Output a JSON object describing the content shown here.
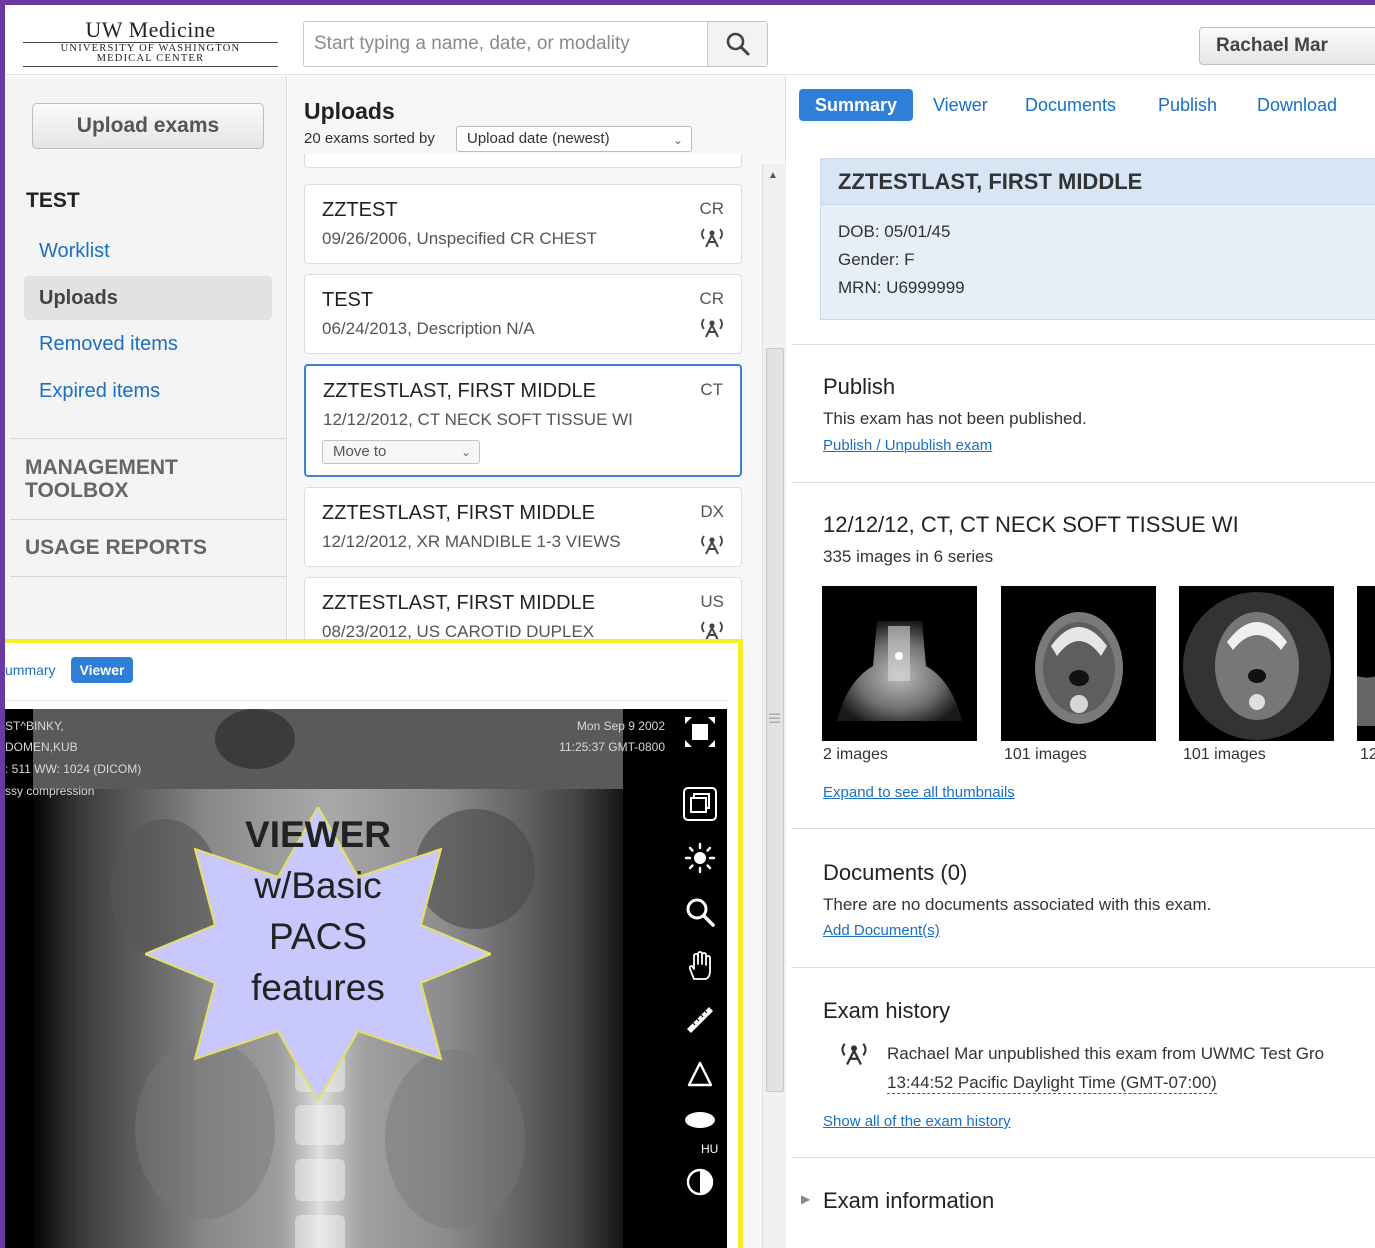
{
  "logo": {
    "line1": "UW Medicine",
    "line2": "UNIVERSITY OF WASHINGTON",
    "line3": "MEDICAL CENTER"
  },
  "search": {
    "placeholder": "Start typing a name, date, or modality",
    "icon": "search-icon"
  },
  "user": {
    "name": "Rachael Mar"
  },
  "sidebar": {
    "upload_label": "Upload exams",
    "group_title": "TEST",
    "items": [
      {
        "label": "Worklist",
        "active": false
      },
      {
        "label": "Uploads",
        "active": true
      },
      {
        "label": "Removed items",
        "active": false
      },
      {
        "label": "Expired items",
        "active": false
      }
    ],
    "management_line1": "MANAGEMENT",
    "management_line2": "TOOLBOX",
    "usage_reports": "USAGE REPORTS"
  },
  "uploads": {
    "title": "Uploads",
    "subtitle": "20 exams sorted by",
    "sort_value": "Upload date (newest)",
    "cards": [
      {
        "name": "ZZTEST",
        "desc": "09/26/2006, Unspecified CR CHEST",
        "modality": "CR"
      },
      {
        "name": "TEST",
        "desc": "06/24/2013, Description N/A",
        "modality": "CR"
      },
      {
        "name": "ZZTESTLAST, FIRST MIDDLE",
        "desc": "12/12/2012, CT NECK SOFT TISSUE WI",
        "modality": "CT",
        "move_label": "Move to"
      },
      {
        "name": "ZZTESTLAST, FIRST MIDDLE",
        "desc": "12/12/2012, XR MANDIBLE 1-3 VIEWS",
        "modality": "DX"
      },
      {
        "name": "ZZTESTLAST, FIRST MIDDLE",
        "desc": "08/23/2012, US CAROTID DUPLEX",
        "modality": "US"
      }
    ]
  },
  "tabs": {
    "summary": "Summary",
    "viewer": "Viewer",
    "documents": "Documents",
    "publish": "Publish",
    "download": "Download"
  },
  "patient": {
    "name": "ZZTESTLAST, FIRST MIDDLE",
    "dob": "DOB: 05/01/45",
    "gender": "Gender: F",
    "mrn": "MRN: U6999999"
  },
  "publish": {
    "title": "Publish",
    "text": "This exam has not been published.",
    "link": "Publish / Unpublish exam"
  },
  "exam": {
    "title": "12/12/12, CT, CT NECK SOFT TISSUE WI",
    "count": "335 images in 6 series",
    "thumbs": [
      {
        "caption": "2 images"
      },
      {
        "caption": "101 images"
      },
      {
        "caption": "101 images"
      },
      {
        "caption": "12"
      }
    ],
    "expand_link": "Expand to see all thumbnails"
  },
  "documents": {
    "title": "Documents (0)",
    "text": "There are no documents associated with this exam.",
    "link": "Add Document(s)"
  },
  "history": {
    "title": "Exam history",
    "entry_line1": "Rachael Mar unpublished this exam from UWMC Test Gro",
    "entry_line2": "13:44:52 Pacific Daylight Time (GMT-07:00)",
    "link": "Show all of the exam history"
  },
  "exam_info": {
    "title": "Exam information"
  },
  "viewer_panel": {
    "tab_summary": "ummary",
    "tab_viewer": "Viewer",
    "overlay_left": [
      "ST^BINKY,",
      "DOMEN,KUB",
      ": 511  WW: 1024 (DICOM)",
      "ssy compression"
    ],
    "overlay_right": [
      "Mon Sep 9 2002",
      "11:25:37 GMT-0800"
    ],
    "hu_label": "HU",
    "callout": [
      "VIEWER",
      "w/Basic",
      "PACS",
      "features"
    ]
  },
  "colors": {
    "brand_purple": "#6a3aa0",
    "accent_blue": "#2f7fd6",
    "link_blue": "#1a6fc1",
    "highlight_yellow": "#f2ef27",
    "callout_fill": "#c8c8ff"
  }
}
